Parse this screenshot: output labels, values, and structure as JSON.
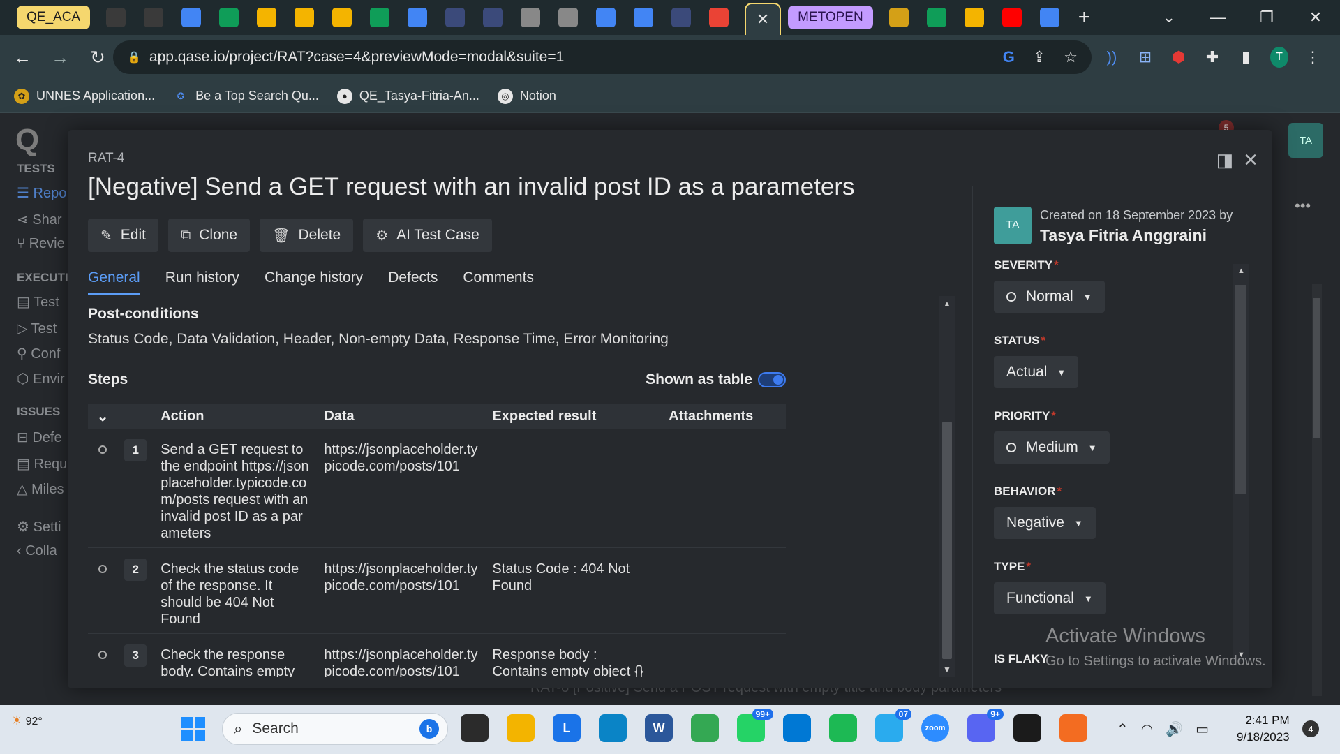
{
  "browser": {
    "tabs": [
      {
        "label": "QE_ACA",
        "style": "yellow"
      },
      {
        "label": "METOPEN",
        "style": "purple"
      }
    ],
    "tab_icons": [
      "github-icon",
      "github-icon",
      "docs-icon",
      "sheets-icon",
      "drive-icon",
      "drive-icon",
      "drive-icon",
      "sheets-icon",
      "docs-icon",
      "app-icon",
      "app-icon",
      "globe-icon",
      "globe-icon",
      "docs-icon",
      "calendar-icon",
      "app-icon",
      "gmail-icon"
    ],
    "active_tab_close": "✕",
    "tab_icons_after": [
      "unnes-icon",
      "sheets-icon",
      "classroom-icon",
      "youtube-icon",
      "translate-icon"
    ],
    "new_tab": "+",
    "url": "app.qase.io/project/RAT?case=4&previewMode=modal&suite=1",
    "profile_initial": "T",
    "bookmarks": [
      {
        "label": "UNNES Application...",
        "icon": "unnes-icon"
      },
      {
        "label": "Be a Top Search Qu...",
        "icon": "search-icon"
      },
      {
        "label": "QE_Tasya-Fitria-An...",
        "icon": "github-icon"
      },
      {
        "label": "Notion",
        "icon": "globe-icon"
      }
    ]
  },
  "app_bg": {
    "sidebar": {
      "tests_head": "TESTS",
      "items_tests": [
        "Repo",
        "Shar",
        "Revie"
      ],
      "execution_head": "EXECUTI",
      "items_execution": [
        "Test",
        "Test",
        "Conf",
        "Envir"
      ],
      "issues_head": "ISSUES",
      "items_issues": [
        "Defe",
        "Requ",
        "Miles"
      ],
      "items_bottom": [
        "Setti",
        "Colla"
      ]
    },
    "avatar": "TA",
    "notification_count": "5",
    "behind_row": "RAT-8    [Positive] Send a POST request with empty title and body parameters"
  },
  "modal": {
    "case_code": "RAT-4",
    "title": "[Negative] Send a GET request with an invalid post ID as a parameters",
    "actions": {
      "edit": "Edit",
      "clone": "Clone",
      "delete": "Delete",
      "ai": "AI Test Case"
    },
    "tabs": [
      "General",
      "Run history",
      "Change history",
      "Defects",
      "Comments"
    ],
    "post_conditions_label": "Post-conditions",
    "post_conditions_text": "Status Code, Data Validation, Header, Non-empty Data, Response Time, Error Monitoring",
    "steps_label": "Steps",
    "shown_as_table": "Shown as table",
    "columns": {
      "action": "Action",
      "data": "Data",
      "expected": "Expected result",
      "attachments": "Attachments"
    },
    "steps": [
      {
        "num": "1",
        "action": "Send a GET request to the endpoint https://jsonplaceholder.typicode.com/posts request with an invalid post ID as a parameters",
        "data": "https://jsonplaceholder.typicode.com/posts/101",
        "expected": ""
      },
      {
        "num": "2",
        "action": "Check the status code of the response. It should be 404 Not Found",
        "data": "https://jsonplaceholder.typicode.com/posts/101",
        "expected": "Status Code : 404 Not Found"
      },
      {
        "num": "3",
        "action": "Check the response body. Contains empty object {}",
        "data": "https://jsonplaceholder.typicode.com/posts/101",
        "expected": "Response body : Contains empty object {}"
      }
    ],
    "created": {
      "avatar": "TA",
      "created_on": "Created on 18 September 2023 by",
      "author": "Tasya Fitria Anggraini"
    },
    "properties": {
      "severity_label": "SEVERITY",
      "severity_value": "Normal",
      "status_label": "STATUS",
      "status_value": "Actual",
      "priority_label": "PRIORITY",
      "priority_value": "Medium",
      "behavior_label": "BEHAVIOR",
      "behavior_value": "Negative",
      "type_label": "TYPE",
      "type_value": "Functional",
      "flaky_label": "IS FLAKY"
    },
    "required_mark": "*"
  },
  "watermark": {
    "line1": "Activate Windows",
    "line2": "Go to Settings to activate Windows."
  },
  "taskbar": {
    "weather_temp": "92°",
    "search_placeholder": "Search",
    "pinned": [
      {
        "name": "task-view-icon",
        "color": "#2b2b2b",
        "text": ""
      },
      {
        "name": "file-explorer-icon",
        "color": "#f3b400",
        "text": ""
      },
      {
        "name": "l-app-icon",
        "color": "#1a73e8",
        "text": "L"
      },
      {
        "name": "edge-icon",
        "color": "#0a84c6",
        "text": ""
      },
      {
        "name": "word-icon",
        "color": "#2b579a",
        "text": "W"
      },
      {
        "name": "chrome-icon",
        "color": "#34a853",
        "text": "",
        "badge": ""
      },
      {
        "name": "whatsapp-icon",
        "color": "#25d366",
        "text": "",
        "badge": "99+"
      },
      {
        "name": "vscode-icon",
        "color": "#0078d4",
        "text": ""
      },
      {
        "name": "spotify-icon",
        "color": "#1db954",
        "text": ""
      },
      {
        "name": "telegram-icon",
        "color": "#2aabee",
        "text": "",
        "badge": "07"
      },
      {
        "name": "zoom-icon",
        "color": "#2d8cff",
        "text": "zoom"
      },
      {
        "name": "discord-icon",
        "color": "#5865f2",
        "text": "",
        "badge": "9+"
      },
      {
        "name": "sticky-notes-icon",
        "color": "#1b1b1b",
        "text": ""
      },
      {
        "name": "pen-app-icon",
        "color": "#f36c21",
        "text": ""
      }
    ],
    "time": "2:41 PM",
    "date": "9/18/2023",
    "notifications": "4"
  }
}
